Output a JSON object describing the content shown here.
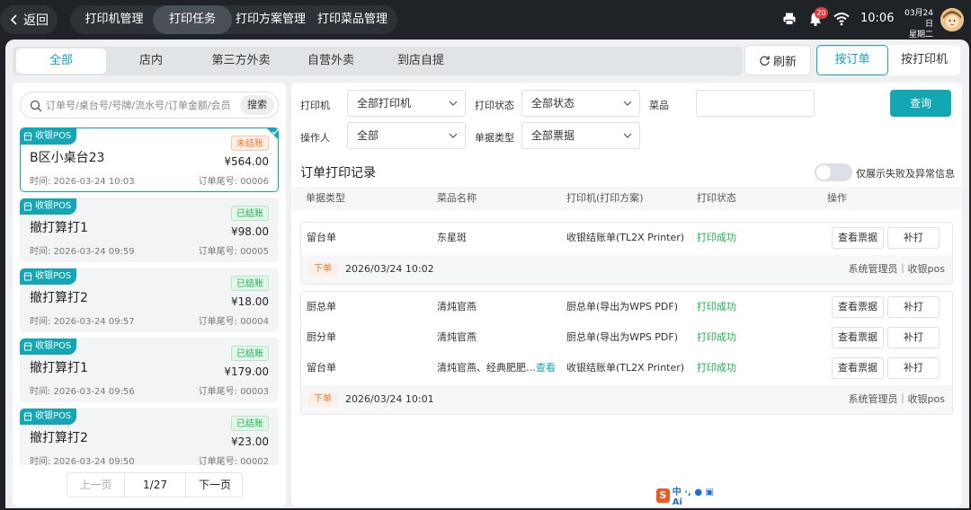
{
  "topbar": {
    "back_label": "返回",
    "tabs": [
      "打印机管理",
      "打印任务",
      "打印方案管理",
      "打印菜品管理"
    ],
    "notification_count": "20",
    "time": "10:06",
    "date": "03月24日",
    "weekday": "星期二"
  },
  "categories": [
    "全部",
    "店内",
    "第三方外卖",
    "自营外卖",
    "到店自提"
  ],
  "toolbar": {
    "refresh_label": "刷新",
    "view_by_order": "按订单",
    "view_by_printer": "按打印机"
  },
  "search": {
    "placeholder": "订单号/桌台号/号牌/流水号/订单金额/会员",
    "button": "搜索"
  },
  "orders": [
    {
      "tag": "收银POS",
      "title": "B区小桌台23",
      "status": "未结账",
      "amount": "¥564.00",
      "time": "时间:  2026-03-24 10:03",
      "tail": "订单尾号:  00006"
    },
    {
      "tag": "收银POS",
      "title": "撤打算打1",
      "status": "已结账",
      "amount": "¥98.00",
      "time": "时间:  2026-03-24 09:59",
      "tail": "订单尾号:  00005"
    },
    {
      "tag": "收银POS",
      "title": "撤打算打2",
      "status": "已结账",
      "amount": "¥18.00",
      "time": "时间:  2026-03-24 09:57",
      "tail": "订单尾号:  00004"
    },
    {
      "tag": "收银POS",
      "title": "撤打算打1",
      "status": "已结账",
      "amount": "¥179.00",
      "time": "时间:  2026-03-24 09:56",
      "tail": "订单尾号:  00003"
    },
    {
      "tag": "收银POS",
      "title": "撤打算打2",
      "status": "已结账",
      "amount": "¥23.00",
      "time": "时间:  2026-03-24 09:50",
      "tail": "订单尾号:  00002"
    }
  ],
  "pager": {
    "prev": "上一页",
    "page": "1/27",
    "next": "下一页"
  },
  "filters": {
    "printer_label": "打印机",
    "printer_value": "全部打印机",
    "status_label": "打印状态",
    "status_value": "全部状态",
    "dish_label": "菜品",
    "dish_value": "",
    "operator_label": "操作人",
    "operator_value": "全部",
    "doc_type_label": "单据类型",
    "doc_type_value": "全部票据",
    "query_button": "查询"
  },
  "records": {
    "title": "订单打印记录",
    "toggle_label": "仅展示失败及异常信息",
    "columns": [
      "单据类型",
      "菜品名称",
      "打印机(打印方案)",
      "打印状态",
      "操作"
    ],
    "view_ticket": "查看票据",
    "reprint": "补打",
    "view_more": "查看",
    "groups": [
      {
        "rows": [
          {
            "type": "留台单",
            "dish": "东星斑",
            "printer": "收银结账单(TL2X Printer)",
            "status": "打印成功"
          }
        ],
        "footer": {
          "tag": "下单",
          "time": "2026/03/24 10:02",
          "operator": "系统管理员｜收银pos"
        }
      },
      {
        "rows": [
          {
            "type": "厨总单",
            "dish": "清炖官燕",
            "printer": "厨总单(导出为WPS PDF)",
            "status": "打印成功"
          },
          {
            "type": "厨分单",
            "dish": "清炖官燕",
            "printer": "厨总单(导出为WPS PDF)",
            "status": "打印成功"
          },
          {
            "type": "留台单",
            "dish": "清炖官燕、经典肥肥…",
            "printer": "收银结账单(TL2X Printer)",
            "status": "打印成功"
          }
        ],
        "footer": {
          "tag": "下单",
          "time": "2026/03/24 10:01",
          "operator": "系统管理员｜收银pos"
        }
      }
    ]
  },
  "ime": {
    "text": "中 ·, ● ▣ Ai"
  },
  "colors": {
    "accent": "#14a6b2",
    "success": "#1fb156",
    "warning": "#f07a2e",
    "topbar": "#1f2328"
  }
}
